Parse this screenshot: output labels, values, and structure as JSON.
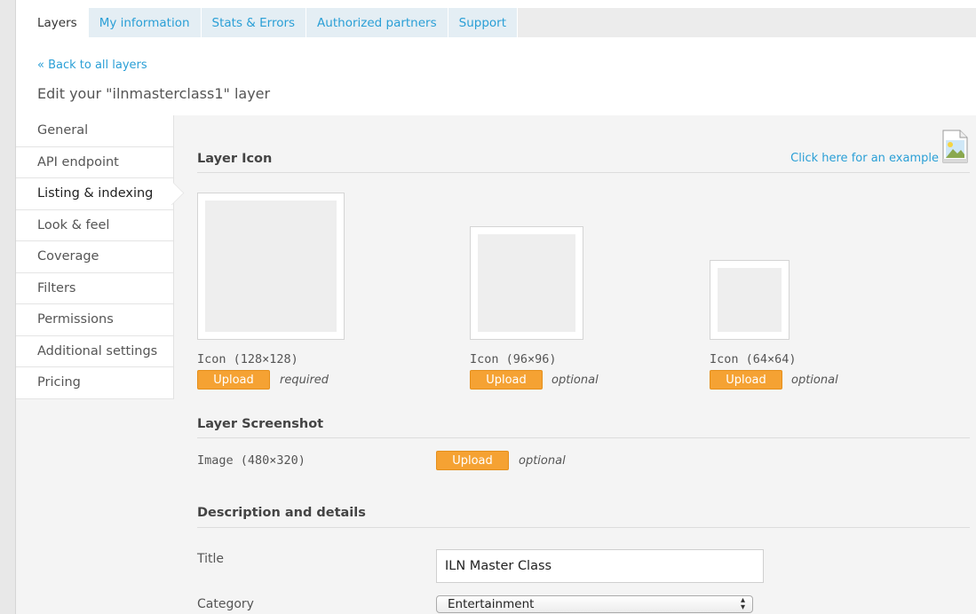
{
  "tabs": [
    {
      "label": "Layers"
    },
    {
      "label": "My information"
    },
    {
      "label": "Stats & Errors"
    },
    {
      "label": "Authorized partners"
    },
    {
      "label": "Support"
    }
  ],
  "back_link": "« Back to all layers",
  "page_title": "Edit your \"ilnmasterclass1\" layer",
  "side_nav": [
    {
      "label": "General"
    },
    {
      "label": "API endpoint"
    },
    {
      "label": "Listing & indexing"
    },
    {
      "label": "Look & feel"
    },
    {
      "label": "Coverage"
    },
    {
      "label": "Filters"
    },
    {
      "label": "Permissions"
    },
    {
      "label": "Additional settings"
    },
    {
      "label": "Pricing"
    }
  ],
  "layer_icon": {
    "heading": "Layer Icon",
    "example_link": "Click here for an example",
    "example_icon": "image-file-icon",
    "icons": [
      {
        "caption": "Icon (128×128)",
        "upload": "Upload",
        "note": "required"
      },
      {
        "caption": "Icon (96×96)",
        "upload": "Upload",
        "note": "optional"
      },
      {
        "caption": "Icon (64×64)",
        "upload": "Upload",
        "note": "optional"
      }
    ]
  },
  "screenshot": {
    "heading": "Layer Screenshot",
    "caption": "Image (480×320)",
    "upload": "Upload",
    "note": "optional"
  },
  "details": {
    "heading": "Description and details",
    "title_label": "Title",
    "title_value": "ILN Master Class",
    "category_label": "Category",
    "category_value": "Entertainment"
  },
  "colors": {
    "link": "#2a9fd6",
    "upload_button": "#f5a233",
    "panel_bg": "#f4f4f4"
  }
}
